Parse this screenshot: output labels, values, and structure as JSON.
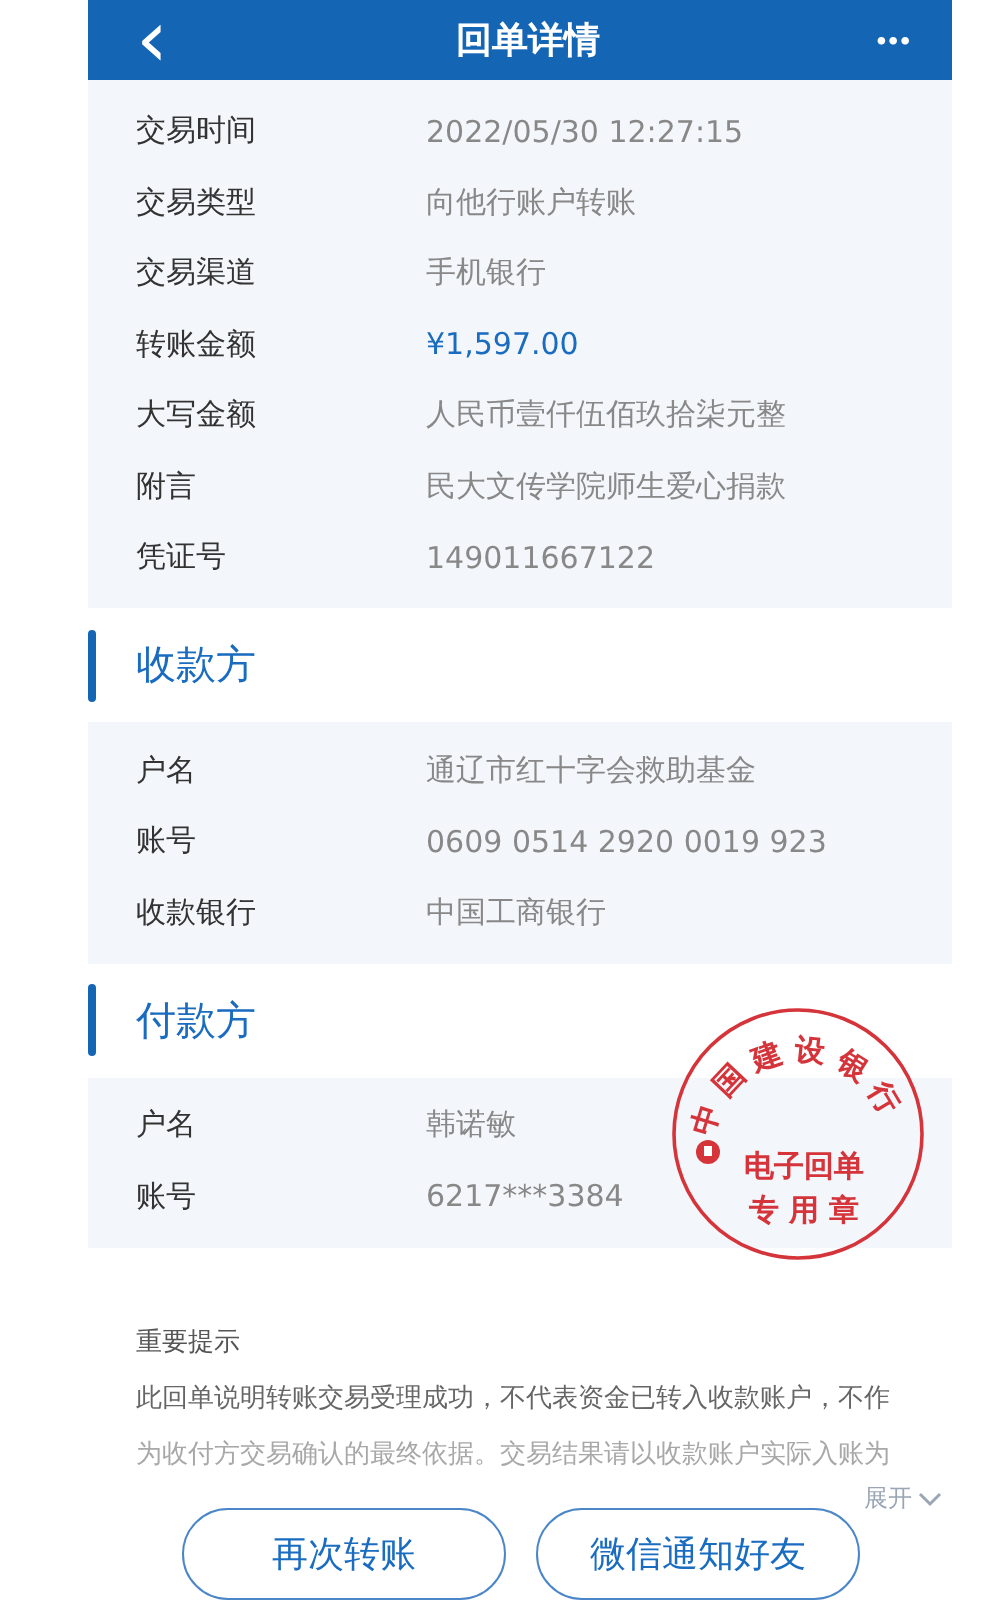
{
  "header": {
    "back": "‹",
    "title": "回单详情",
    "more": "•••"
  },
  "details": [
    {
      "label": "交易时间",
      "value": "2022/05/30  12:27:15",
      "kind": "plain"
    },
    {
      "label": "交易类型",
      "value": "向他行账户转账",
      "kind": "plain"
    },
    {
      "label": "交易渠道",
      "value": "手机银行",
      "kind": "plain"
    },
    {
      "label": "转账金额",
      "value": "¥1,597.00",
      "kind": "amount"
    },
    {
      "label": "大写金额",
      "value": "人民币壹仟伍佰玖拾柒元整",
      "kind": "plain"
    },
    {
      "label": "附言",
      "value": "民大文传学院师生爱心捐款",
      "kind": "plain"
    },
    {
      "label": "凭证号",
      "value": "149011667122",
      "kind": "plain"
    }
  ],
  "payee": {
    "title": "收款方",
    "rows": [
      {
        "label": "户名",
        "value": "通辽市红十字会救助基金"
      },
      {
        "label": "账号",
        "value": "0609 0514 2920 0019 923"
      },
      {
        "label": "收款银行",
        "value": "中国工商银行"
      }
    ]
  },
  "payer": {
    "title": "付款方",
    "rows": [
      {
        "label": "户名",
        "value": "韩诺敏"
      },
      {
        "label": "账号",
        "value": "6217***3384"
      }
    ]
  },
  "stamp": {
    "arc": "中国建设银行",
    "line_1": "电子回单",
    "line_2": "专 用 章"
  },
  "notice": {
    "title": "重要提示",
    "line_1": "此回单说明转账交易受理成功，不代表资金已转入收款账户，不作",
    "line_2": "为收付方交易确认的最终依据。交易结果请以收款账户实际入账为",
    "expand": "展开"
  },
  "buttons": [
    "再次转账",
    "微信通知好友"
  ]
}
